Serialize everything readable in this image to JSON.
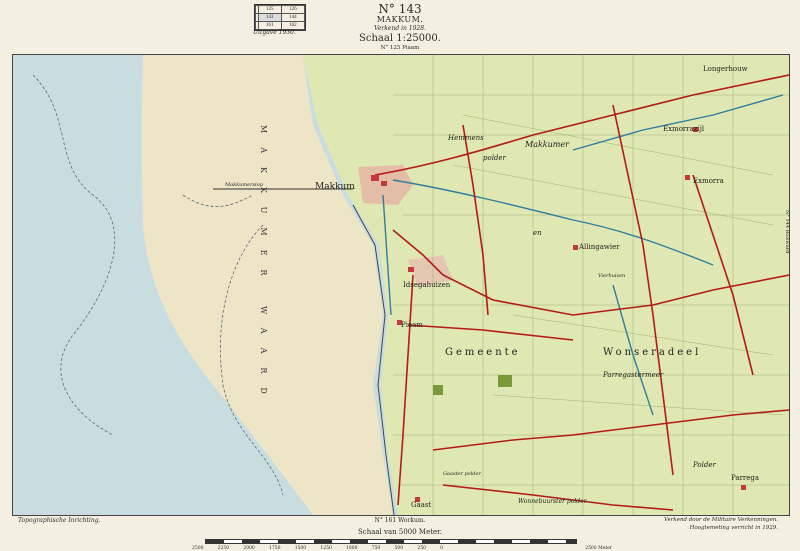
{
  "header": {
    "sheet_number": "N° 143",
    "sheet_name": "MAKKUM.",
    "herkend": "Verkend in 1928.",
    "schaal": "Schaal 1:25000.",
    "north_neighbour": "N° 125 Piaam",
    "uitgave": "Uitgave 1930.",
    "index_grid": [
      [
        "125",
        "126"
      ],
      [
        "",
        "143",
        "144"
      ],
      [
        "",
        "161",
        "162"
      ]
    ]
  },
  "footer": {
    "left_credit": "Topographische Inrichting.",
    "south_neighbour": "N° 161 Workum.",
    "right_credit": "Verkend door de Militaire Verkenningen.",
    "right_credit2": "Hoogtemeting verricht in 1929.",
    "scale_title": "Schaal van 5000 Meter.",
    "scale_ticks": [
      "2500",
      "2250",
      "2000",
      "1750",
      "1500",
      "1250",
      "1000",
      "750",
      "500",
      "250",
      "0",
      "",
      "",
      "",
      "",
      "",
      "",
      "",
      "",
      "",
      "2500 Meter"
    ]
  },
  "side_labels": {
    "east": "N° 144 Bolsward"
  },
  "places": [
    {
      "id": "makkum",
      "label": "Makkum"
    },
    {
      "id": "idsegahuizen",
      "label": "Idsegahuizen"
    },
    {
      "id": "piaam",
      "label": "Piaam"
    },
    {
      "id": "allingawier",
      "label": "Allingawier"
    },
    {
      "id": "exmorra",
      "label": "Exmorra"
    },
    {
      "id": "exmorrazijl",
      "label": "Exmorrazijl"
    },
    {
      "id": "longerhouw",
      "label": "Longerhouw"
    },
    {
      "id": "gaast",
      "label": "Gaast"
    },
    {
      "id": "parrega",
      "label": "Parrega"
    }
  ],
  "map_labels": {
    "makkumerslop": "Makkumerslop",
    "makkumer": "Makkumer",
    "hemmens": "Hemmens",
    "polder1": "polder",
    "en": "en",
    "vierhuisen": "Vierhuisen",
    "gemeente": "Gemeente",
    "wonseradeel": "Wonseradeel",
    "parregastermeer": "Parregastermeer",
    "polder2": "Polder",
    "wonnebuurster": "Wonnebuurster polder",
    "gaaster": "Gaaster polder",
    "sea_vertical": "MAKKUMER WAARD"
  },
  "colors": {
    "sea": "#c9dde0",
    "sand": "#eee4c6",
    "land": "#dfe8b2",
    "road": "#b31a1a",
    "water": "#2e7f9e",
    "town": "#c23a3a"
  }
}
